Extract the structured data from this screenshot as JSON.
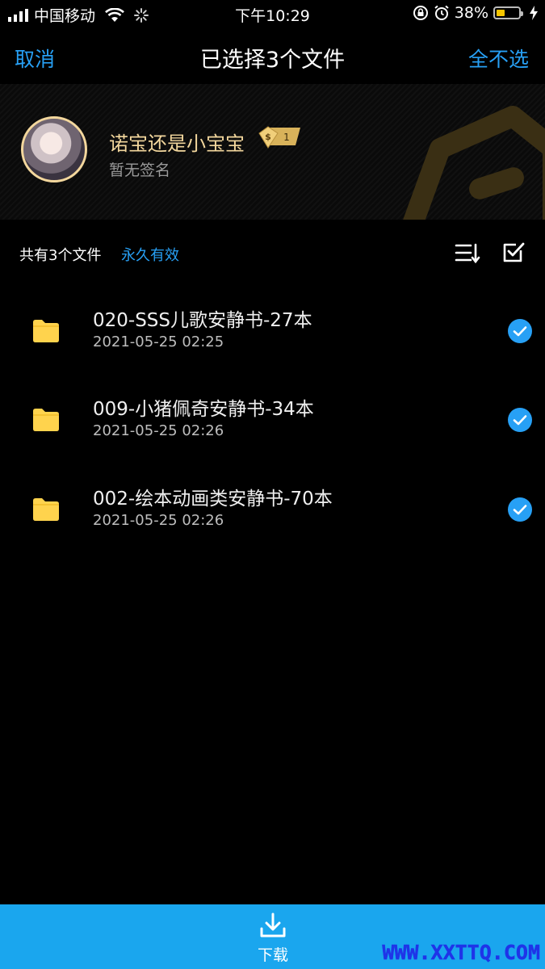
{
  "status_bar": {
    "carrier": "中国移动",
    "time": "下午10:29",
    "battery_percent": "38%",
    "battery_level": 0.38,
    "icons": [
      "signal-icon",
      "wifi-icon",
      "activity-spinner-icon",
      "orientation-lock-icon",
      "alarm-icon",
      "battery-icon",
      "charging-bolt-icon"
    ]
  },
  "header": {
    "cancel_label": "取消",
    "title": "已选择3个文件",
    "deselect_all_label": "全不选"
  },
  "profile": {
    "username": "诺宝还是小宝宝",
    "signature": "暂无签名",
    "vip_level": "1",
    "name_color": "#f3d79d"
  },
  "summary": {
    "file_count_label": "共有3个文件",
    "validity_label": "永久有效",
    "icons": [
      "sort-icon",
      "select-all-icon"
    ]
  },
  "files": [
    {
      "name": "020-SSS儿歌安静书-27本",
      "date": "2021-05-25 02:25",
      "selected": true
    },
    {
      "name": "009-小猪佩奇安静书-34本",
      "date": "2021-05-25 02:26",
      "selected": true
    },
    {
      "name": "002-绘本动画类安静书-70本",
      "date": "2021-05-25 02:26",
      "selected": true
    }
  ],
  "bottom_bar": {
    "download_label": "下载",
    "watermark": "WWW.XXTTQ.COM"
  },
  "colors": {
    "accent": "#27a0f5",
    "bottom_bar": "#1aa6ee",
    "folder": "#ffd34d",
    "background": "#000000"
  }
}
